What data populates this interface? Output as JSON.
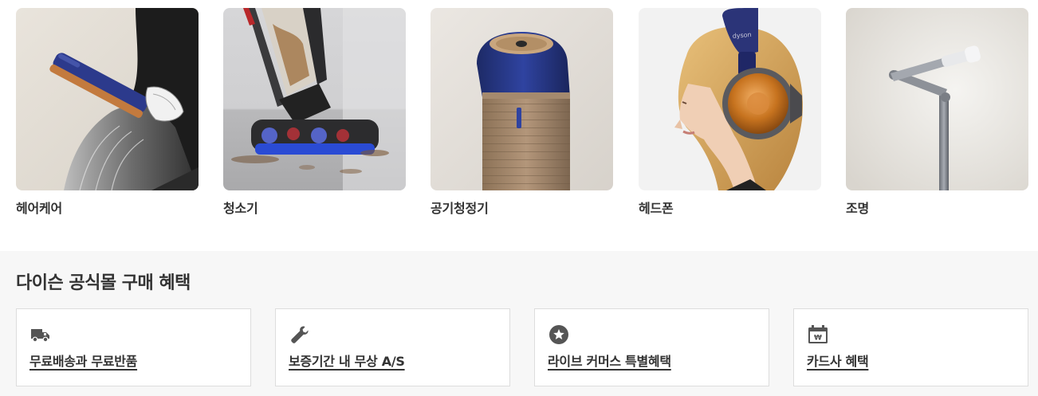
{
  "categories": [
    {
      "label": "헤어케어",
      "image": "hair-straightener-photo"
    },
    {
      "label": "청소기",
      "image": "wet-vacuum-photo"
    },
    {
      "label": "공기청정기",
      "image": "air-purifier-photo"
    },
    {
      "label": "헤드폰",
      "image": "headphones-photo"
    },
    {
      "label": "조명",
      "image": "lamp-photo"
    }
  ],
  "benefits": {
    "title": "다이슨 공식몰 구매 혜택",
    "items": [
      {
        "label": "무료배송과 무료반품",
        "icon": "truck-icon"
      },
      {
        "label": "보증기간 내 무상 A/S",
        "icon": "wrench-icon"
      },
      {
        "label": "라이브 커머스 특별혜택",
        "icon": "star-icon"
      },
      {
        "label": "카드사 혜택",
        "icon": "card-calendar-icon"
      }
    ]
  },
  "colors": {
    "text": "#333333",
    "section_bg": "#f7f7f7",
    "card_border": "#dddddd",
    "icon": "#555555"
  }
}
